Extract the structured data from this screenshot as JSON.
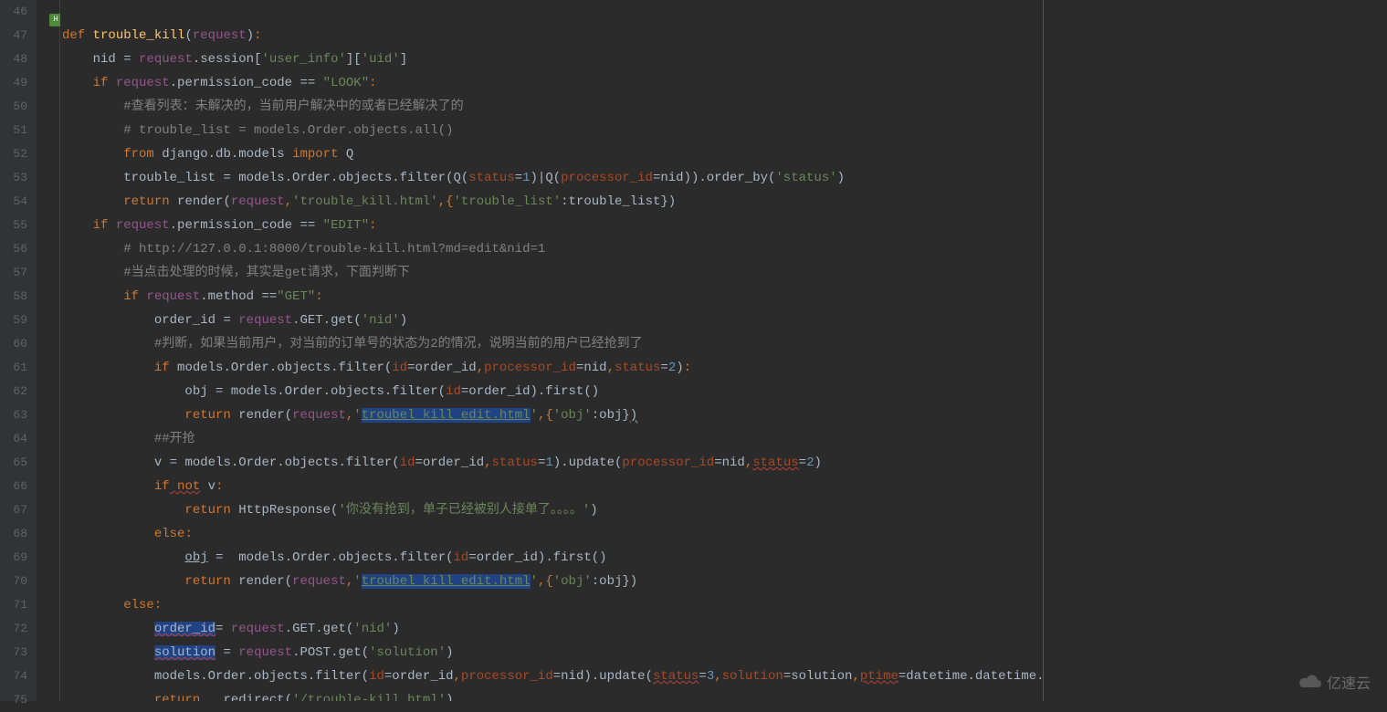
{
  "lines": {
    "start": 46,
    "end": 75
  },
  "code": {
    "l47": {
      "def": "def",
      "name": "trouble_kill",
      "lp": "(",
      "arg": "request",
      "rp": ")",
      "colon": ":"
    },
    "l48": {
      "var": "nid",
      "eq": " = ",
      "req": "request",
      "rest": ".session[",
      "s1": "'user_info'",
      "mid": "][",
      "s2": "'uid'",
      "end": "]"
    },
    "l49": {
      "iff": "if",
      "req": "request",
      "attr": ".permission_code ",
      "eq": "==",
      "str": " \"LOOK\"",
      "colon": ":"
    },
    "l50": {
      "c": "#查看列表：未解决的，当前用户解决中的或者已经解决了的"
    },
    "l51": {
      "c": "# trouble_list = models.Order.objects.all()"
    },
    "l52": {
      "from": "from",
      "mod": " django.db.models ",
      "imp": "import",
      "q": " Q"
    },
    "l53": {
      "a": "trouble_list ",
      "eq": "=",
      "b": " models.Order.objects.filter(Q(",
      "p1": "status",
      "e1": "=",
      "n1": "1",
      "c": ")|Q(",
      "p2": "processor_id",
      "e2": "=",
      "d": "nid)).order_by(",
      "s": "'status'",
      "end": ")"
    },
    "l54": {
      "ret": "return",
      "a": " render(",
      "req": "request",
      "c1": ",",
      "s1": "'trouble_kill.html'",
      "c2": ",{",
      "s2": "'trouble_list'",
      "c3": ":trouble_list})"
    },
    "l55": {
      "iff": "if",
      "req": " request",
      "attr": ".permission_code ",
      "eq": "==",
      "str": " \"EDIT\"",
      "colon": ":"
    },
    "l56": {
      "c": "# http://127.0.0.1:8000/trouble-kill.html?md=edit&nid=1"
    },
    "l57": {
      "c": "#当点击处理的时候，其实是get请求，下面判断下"
    },
    "l58": {
      "iff": "if",
      "req": " request",
      "attr": ".method ",
      "eq": "==",
      "str": "\"GET\"",
      "colon": ":"
    },
    "l59": {
      "a": "order_id ",
      "eq": "=",
      "req": " request",
      "b": ".GET.get(",
      "s": "'nid'",
      "end": ")"
    },
    "l60": {
      "c": "#判断，如果当前用户，对当前的订单号的状态为2的情况，说明当前的用户已经抢到了"
    },
    "l61": {
      "iff": "if",
      "a": " models.Order.objects.filter(",
      "p1": "id",
      "e1": "=",
      "b": "order_id",
      "c1": ",",
      "p2": "processor_id",
      "e2": "=",
      "c": "nid",
      "c2": ",",
      "p3": "status",
      "e3": "=",
      "n": "2",
      "end": ")",
      "colon": ":"
    },
    "l62": {
      "a": "obj ",
      "eq": "=",
      "b": " models.Order.objects.filter(",
      "p": "id",
      "e": "=",
      "c": "order_id).first()"
    },
    "l63": {
      "ret": "return",
      "a": " render(",
      "req": "request",
      "c1": ",",
      "s1": "'",
      "link": "troubel_kill_edit.html",
      "s1b": "'",
      "c2": ",{",
      "s2": "'obj'",
      "c3": ":obj}",
      "err": ")"
    },
    "l64": {
      "c": "##开抢"
    },
    "l65": {
      "a": "v ",
      "eq": "=",
      "b": " models.Order.objects.filter(",
      "p1": "id",
      "e1": "=",
      "c": "order_id",
      "c1": ",",
      "p2": "status",
      "e2": "=",
      "n1": "1",
      "d": ").update(",
      "p3": "processor_id",
      "e3": "=",
      "e": "nid",
      "c2": ",",
      "p4": "status",
      "e4": "=",
      "n2": "2",
      "end": ")"
    },
    "l66": {
      "iff": "if",
      "nt": " not",
      "v": " v",
      "colon": ":"
    },
    "l67": {
      "ret": "return",
      "a": " HttpResponse(",
      "s": "'你没有抢到，单子已经被别人接单了。。。。'",
      "end": ")"
    },
    "l68": {
      "els": "else",
      "colon": ":"
    },
    "l69": {
      "obj": "obj",
      "eq": " = ",
      "a": " models.Order.objects.filter(",
      "p": "id",
      "e": "=",
      "b": "order_id).first()"
    },
    "l70": {
      "ret": "return",
      "a": " render(",
      "req": "request",
      "c1": ",",
      "s1": "'",
      "link": "troubel_kill_edit.html",
      "s1b": "'",
      "c2": ",{",
      "s2": "'obj'",
      "c3": ":obj})"
    },
    "l71": {
      "els": "else",
      "colon": ":"
    },
    "l72": {
      "oid": "order_id",
      "eq": "=",
      "req": " request",
      "a": ".GET.get(",
      "s": "'nid'",
      "end": ")"
    },
    "l73": {
      "sol": "solution",
      "eq": " = ",
      "req": "request",
      "a": ".POST.get(",
      "s": "'solution'",
      "end": ")"
    },
    "l74": {
      "a": "models.Order.objects.filter(",
      "p1": "id",
      "e1": "=",
      "b": "order_id",
      "c1": ",",
      "p2": "processor_id",
      "e2": "=",
      "c": "nid).update(",
      "p3": "status",
      "e3": "=",
      "n": "3",
      "c2": ",",
      "p4": "solution",
      "e4": "=",
      "d": "solution",
      "c3": ",",
      "p5": "ptime",
      "e5": "=",
      "e": "datetime.datetime.now())"
    },
    "l75": {
      "ret": "return",
      "a": "   redirect(",
      "s": "'/trouble-kill.html'",
      "err": ")"
    }
  },
  "watermark": "亿速云"
}
